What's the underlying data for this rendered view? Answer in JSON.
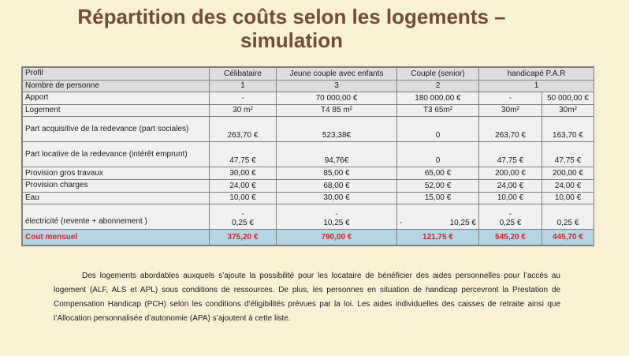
{
  "title": "Répartition des coûts selon les logements – simulation",
  "table": {
    "headers": [
      "Profil",
      "Célibataire",
      "Jeune couple avec enfants",
      "Couple (senior)",
      "handicapé P.A.R"
    ],
    "rows": {
      "nombre": {
        "label": "Nombre de personne",
        "v": [
          "1",
          "3",
          "2",
          "1"
        ]
      },
      "apport": {
        "label": "Apport",
        "v": [
          "-",
          "70 000,00 €",
          "180 000,00 €",
          "-",
          "50 000,00 €"
        ]
      },
      "logement": {
        "label": "Logement",
        "v": [
          "30 m²",
          "T4 85 m²",
          "T3 65m²",
          "30m²",
          "30m²"
        ]
      },
      "part_acq": {
        "label": "Part acquisitive de la redevance (part sociales)",
        "v": [
          "263,70 €",
          "523,38€",
          "0",
          "263,70 €",
          "163,70 €"
        ]
      },
      "part_loc": {
        "label": "Part locative de la redevance (intérêt emprunt)",
        "v": [
          "47,75 €",
          "94,76€",
          "0",
          "47,75 €",
          "47,75 €"
        ]
      },
      "gros_travaux": {
        "label": "Provision gros travaux",
        "v": [
          "30,00 €",
          "85,00 €",
          "65,00 €",
          "200,00 €",
          "200,00 €"
        ]
      },
      "charges": {
        "label": "Provision charges",
        "v": [
          "24,00 €",
          "68,00 €",
          "52,00 €",
          "24,00 €",
          "24,00 €"
        ]
      },
      "eau": {
        "label": "Eau",
        "v": [
          "10,00 €",
          "30,00 €",
          "15,00 €",
          "10,00 €",
          "10,00 €"
        ]
      },
      "electricite": {
        "label": "électricité (revente + abonnement )",
        "dash": "-",
        "v": [
          "0,25 €",
          "10,25 €",
          "10,25 €",
          "0,25 €",
          "0,25 €"
        ]
      },
      "total": {
        "label": "Cout mensuel",
        "v": [
          "375,20 €",
          "790,00 €",
          "121,75 €",
          "545,20 €",
          "445,70 €"
        ]
      }
    }
  },
  "paragraph": "Des logements abordables auxquels s’ajoute la possibilité pour les locataire de bénéficier des aides personnelles pour l’accès au logement (ALF, ALS et APL) sous conditions de ressources. De plus, les personnes en situation de handicap percevront la Prestation de Compensation Handicap (PCH) selon les conditions d’éligibilités prévues par la loi. Les aides individuelles des caisses de retraite ainsi que l’Allocation personnalisée d’autonomie (APA) s’ajoutent à cette liste."
}
